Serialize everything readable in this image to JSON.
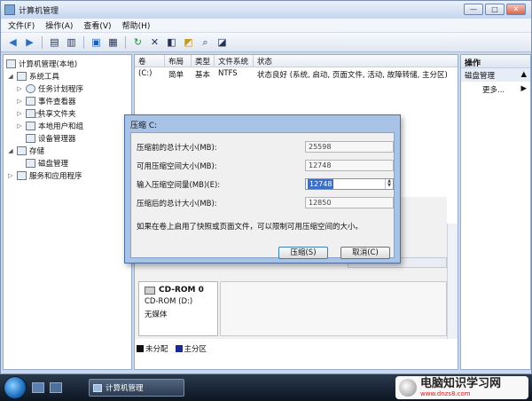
{
  "window": {
    "title": "计算机管理",
    "min_label": "—",
    "max_label": "□",
    "close_label": "✕"
  },
  "menu": [
    "文件(F)",
    "操作(A)",
    "查看(V)",
    "帮助(H)"
  ],
  "tree": {
    "root": "计算机管理(本地)",
    "system_tools": "系统工具",
    "task_scheduler": "任务计划程序",
    "event_viewer": "事件查看器",
    "shared_folders": "共享文件夹",
    "local_users": "本地用户和组",
    "device_manager": "设备管理器",
    "storage": "存储",
    "disk_management": "磁盘管理",
    "services_apps": "服务和应用程序"
  },
  "volume_table": {
    "headers": [
      "卷",
      "布局",
      "类型",
      "文件系统",
      "状态"
    ],
    "rows": [
      [
        "(C:)",
        "简单",
        "基本",
        "NTFS",
        "状态良好 (系统, 启动, 页面文件, 活动, 故障转储, 主分区)"
      ]
    ]
  },
  "disk": {
    "name": "CD-ROM 0",
    "drive": "CD-ROM (D:)",
    "media": "无媒体"
  },
  "legend": {
    "unallocated": "未分配",
    "primary": "主分区",
    "unallocated_color": "#111111",
    "primary_color": "#1c2a8a"
  },
  "actions": {
    "header": "操作",
    "section": "磁盘管理",
    "more": "更多...",
    "section_arrow": "▲",
    "more_arrow": "▶"
  },
  "dialog": {
    "title": "压缩 C:",
    "total_before_label": "压缩前的总计大小(MB):",
    "total_before_value": "25598",
    "available_label": "可用压缩空间大小(MB):",
    "available_value": "12748",
    "input_label": "输入压缩空间量(MB)(E):",
    "input_value": "12748",
    "total_after_label": "压缩后的总计大小(MB):",
    "total_after_value": "12850",
    "note": "如果在卷上启用了快照或页面文件，可以限制可用压缩空间的大小。",
    "shrink_button": "压缩(S)",
    "cancel_button": "取消(C)"
  },
  "taskbar": {
    "task_label": "计算机管理"
  },
  "watermark": {
    "text": "电脑知识学习网",
    "url": "www.dnzs8.com"
  }
}
